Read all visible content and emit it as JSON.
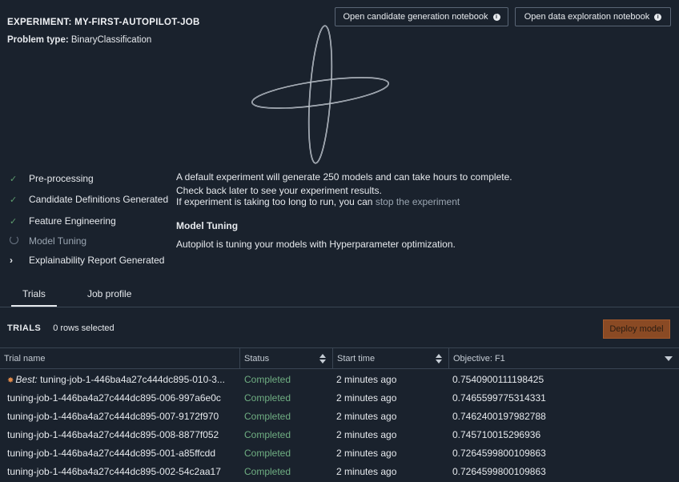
{
  "experiment": {
    "title": "EXPERIMENT: MY-FIRST-AUTOPILOT-JOB",
    "problem_type_label": "Problem type:",
    "problem_type_value": "BinaryClassification"
  },
  "buttons": {
    "candidate_notebook": "Open candidate generation notebook",
    "data_notebook": "Open data exploration notebook"
  },
  "steps": [
    {
      "label": "Pre-processing",
      "state": "done"
    },
    {
      "label": "Candidate Definitions Generated",
      "state": "done"
    },
    {
      "label": "Feature Engineering",
      "state": "done"
    },
    {
      "label": "Model Tuning",
      "state": "in-progress"
    },
    {
      "label": "Explainability Report Generated",
      "state": "collapsed"
    }
  ],
  "messages": {
    "line1": "A default experiment will generate 250 models and can take hours to complete.",
    "line2": "Check back later to see your experiment results.",
    "line3_prefix": "If experiment is taking too long to run, you can ",
    "line3_link": "stop the experiment",
    "stage_title": "Model Tuning",
    "stage_desc": "Autopilot is tuning your models with Hyperparameter optimization."
  },
  "tabs": [
    {
      "label": "Trials",
      "active": true
    },
    {
      "label": "Job profile",
      "active": false
    }
  ],
  "trials": {
    "heading": "TRIALS",
    "selection": "0 rows selected",
    "deploy_label": "Deploy model",
    "columns": [
      "Trial name",
      "Status",
      "Start time",
      "Objective: F1"
    ],
    "best_label": "Best:",
    "rows": [
      {
        "name": "tuning-job-1-446ba4a27c444dc895-010-3...",
        "status": "Completed",
        "time": "2 minutes ago",
        "objective": "0.7540900111198425",
        "best": true
      },
      {
        "name": "tuning-job-1-446ba4a27c444dc895-006-997a6e0c",
        "status": "Completed",
        "time": "2 minutes ago",
        "objective": "0.7465599775314331",
        "best": false
      },
      {
        "name": "tuning-job-1-446ba4a27c444dc895-007-9172f970",
        "status": "Completed",
        "time": "2 minutes ago",
        "objective": "0.7462400197982788",
        "best": false
      },
      {
        "name": "tuning-job-1-446ba4a27c444dc895-008-8877f052",
        "status": "Completed",
        "time": "2 minutes ago",
        "objective": "0.745710015296936",
        "best": false
      },
      {
        "name": "tuning-job-1-446ba4a27c444dc895-001-a85ffcdd",
        "status": "Completed",
        "time": "2 minutes ago",
        "objective": "0.7264599800109863",
        "best": false
      },
      {
        "name": "tuning-job-1-446ba4a27c444dc895-002-54c2aa17",
        "status": "Completed",
        "time": "2 minutes ago",
        "objective": "0.7264599800109863",
        "best": false
      }
    ]
  },
  "colors": {
    "background": "#1a222d",
    "success": "#6fae82",
    "deploy": "#8a4a24"
  }
}
